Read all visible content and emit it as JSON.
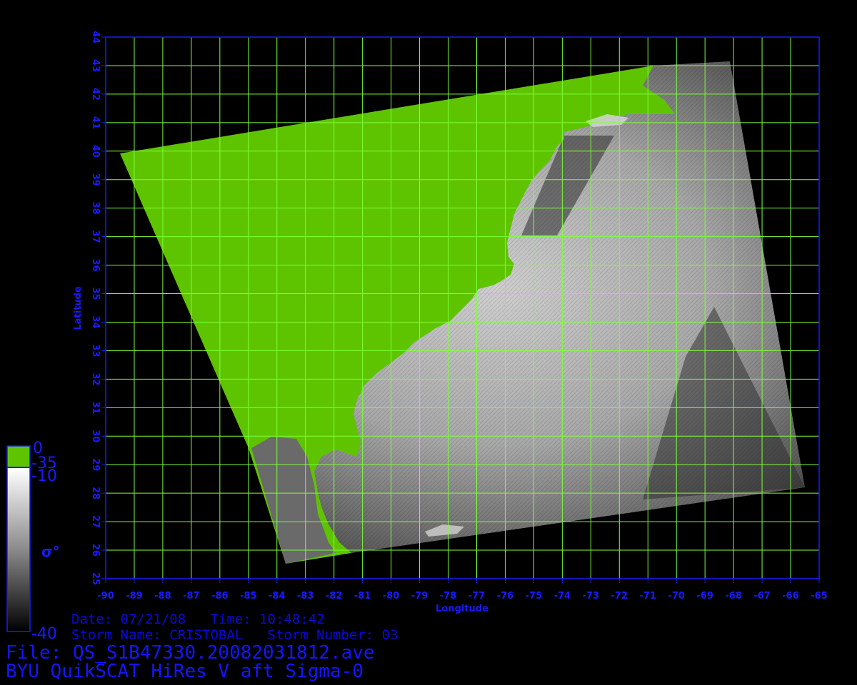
{
  "map": {
    "lon_min": -90,
    "lon_max": -65,
    "lat_min": 25,
    "lat_max": 44,
    "x_ticks": [
      "-90",
      "-89",
      "-88",
      "-87",
      "-86",
      "-85",
      "-84",
      "-83",
      "-82",
      "-81",
      "-80",
      "-79",
      "-78",
      "-77",
      "-76",
      "-75",
      "-74",
      "-73",
      "-72",
      "-71",
      "-70",
      "-69",
      "-68",
      "-67",
      "-66",
      "-65"
    ],
    "y_ticks": [
      "25",
      "26",
      "27",
      "28",
      "29",
      "30",
      "31",
      "32",
      "33",
      "34",
      "35",
      "36",
      "37",
      "38",
      "39",
      "40",
      "41",
      "42",
      "43",
      "44"
    ],
    "xlabel": "Longitude",
    "ylabel": "Latitude",
    "grid_color": "#7cff3a",
    "axis_color": "#1a1aff",
    "land_color": "#5ec400"
  },
  "colorbar": {
    "top_label": "0",
    "label_minus35": "-35",
    "label_minus10": "-10",
    "bottom_label": "-40",
    "symbol": "σ°"
  },
  "info": {
    "date_line": "Date: 07/21/08   Time: 10:48:42",
    "storm_line": "Storm Name: CRISTOBAL   Storm Number: 03",
    "file_line": "File: QS_S1B47330.20082031812.ave",
    "title_line": "BYU QuikSCAT HiRes V aft Sigma-0"
  }
}
